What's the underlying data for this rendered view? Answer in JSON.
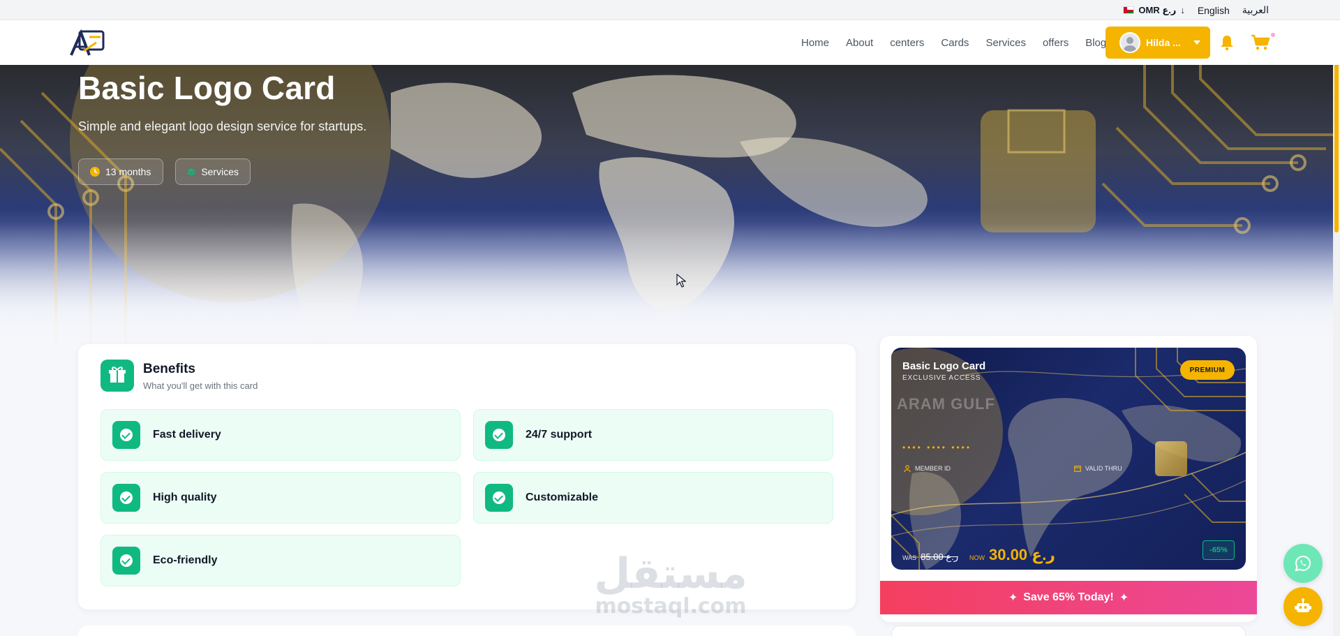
{
  "topbar": {
    "currency": "OMR ر.ع",
    "currency_arrow": "↓",
    "language_en": "English",
    "language_ar": "العربية"
  },
  "nav": {
    "links": [
      "Home",
      "About",
      "centers",
      "Cards",
      "Services",
      "offers",
      "Blog"
    ],
    "user_name": "Hilda ..."
  },
  "hero": {
    "title": "Basic Logo Card",
    "subtitle": "Simple and elegant logo design service for startups.",
    "duration_chip": "13 months",
    "category_chip": "Services"
  },
  "benefits": {
    "title": "Benefits",
    "subtitle": "What you'll get with this card",
    "items": [
      "Fast delivery",
      "24/7 support",
      "High quality",
      "Customizable",
      "Eco-friendly"
    ]
  },
  "card": {
    "title": "Basic Logo Card",
    "exclusive": "EXCLUSIVE ACCESS",
    "brand": "ARAM GULF",
    "badge": "PREMIUM",
    "dots": "•••• •••• ••••",
    "member_label": "MEMBER ID",
    "valid_label": "VALID THRU",
    "was_label": "WAS",
    "was_price": "ر.ع 85.00",
    "now_label": "NOW",
    "now_price": "ر.ع 30.00",
    "discount": "-65%"
  },
  "save_banner": "Save 65% Today!",
  "watermark": {
    "arabic": "مستقل",
    "latin": "mostaql.com"
  },
  "colors": {
    "accent": "#f5b400",
    "success": "#10b981",
    "promo": "#f43f5e"
  }
}
